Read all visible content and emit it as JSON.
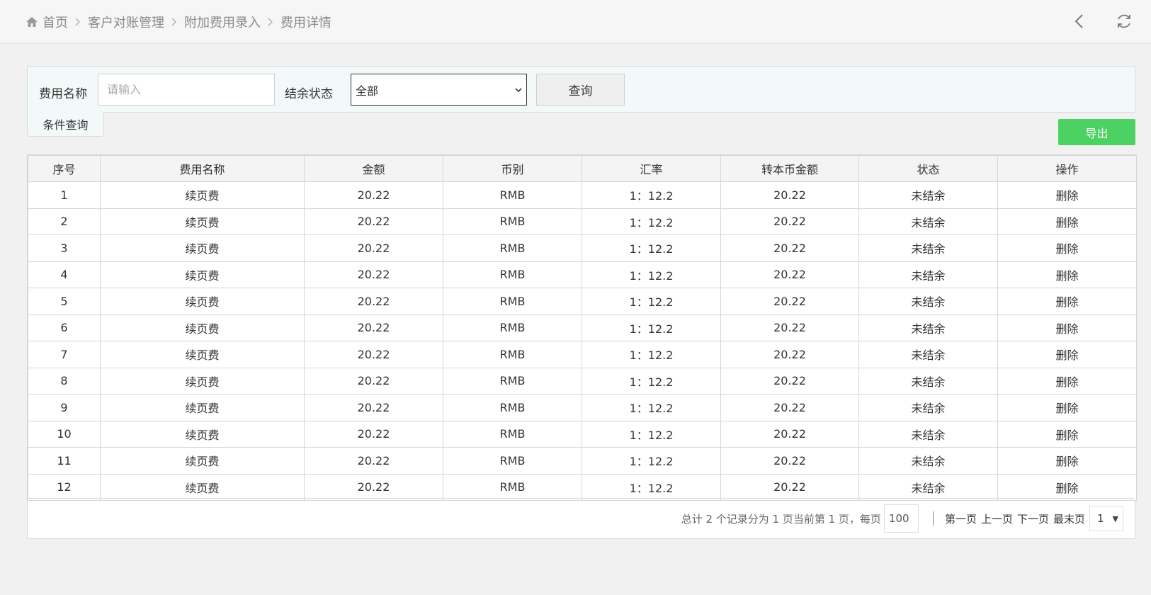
{
  "breadcrumb": {
    "items": [
      "首页",
      "客户对账管理",
      "附加费用录入",
      "费用详情"
    ]
  },
  "filters": {
    "name_label": "费用名称",
    "name_placeholder": "请输入",
    "status_label": "结余状态",
    "status_value": "全部",
    "query_label": "查询",
    "cond_tab_label": "条件查询"
  },
  "toolbar": {
    "export_label": "导出"
  },
  "table": {
    "headers": [
      "序号",
      "费用名称",
      "金额",
      "币别",
      "汇率",
      "转本币金额",
      "状态",
      "操作"
    ],
    "rows": [
      [
        "1",
        "续页费",
        "20.22",
        "RMB",
        "1：12.2",
        "20.22",
        "未结余",
        "删除"
      ],
      [
        "2",
        "续页费",
        "20.22",
        "RMB",
        "1：12.2",
        "20.22",
        "未结余",
        "删除"
      ],
      [
        "3",
        "续页费",
        "20.22",
        "RMB",
        "1：12.2",
        "20.22",
        "未结余",
        "删除"
      ],
      [
        "4",
        "续页费",
        "20.22",
        "RMB",
        "1：12.2",
        "20.22",
        "未结余",
        "删除"
      ],
      [
        "5",
        "续页费",
        "20.22",
        "RMB",
        "1：12.2",
        "20.22",
        "未结余",
        "删除"
      ],
      [
        "6",
        "续页费",
        "20.22",
        "RMB",
        "1：12.2",
        "20.22",
        "未结余",
        "删除"
      ],
      [
        "7",
        "续页费",
        "20.22",
        "RMB",
        "1：12.2",
        "20.22",
        "未结余",
        "删除"
      ],
      [
        "8",
        "续页费",
        "20.22",
        "RMB",
        "1：12.2",
        "20.22",
        "未结余",
        "删除"
      ],
      [
        "9",
        "续页费",
        "20.22",
        "RMB",
        "1：12.2",
        "20.22",
        "未结余",
        "删除"
      ],
      [
        "10",
        "续页费",
        "20.22",
        "RMB",
        "1：12.2",
        "20.22",
        "未结余",
        "删除"
      ],
      [
        "11",
        "续页费",
        "20.22",
        "RMB",
        "1：12.2",
        "20.22",
        "未结余",
        "删除"
      ],
      [
        "12",
        "续页费",
        "20.22",
        "RMB",
        "1：12.2",
        "20.22",
        "未结余",
        "删除"
      ]
    ]
  },
  "pager": {
    "summary": "总计 2 个记录分为 1 页当前第 1 页，每页",
    "page_size": "100",
    "first": "第一页",
    "prev": "上一页",
    "next": "下一页",
    "last": "最末页",
    "current_page": "1"
  },
  "colors": {
    "export_green": "#4cd263",
    "filter_bg": "#f3f8f8"
  },
  "icons": {
    "home": "home-icon",
    "back": "chevron-left-icon",
    "refresh": "refresh-icon"
  }
}
